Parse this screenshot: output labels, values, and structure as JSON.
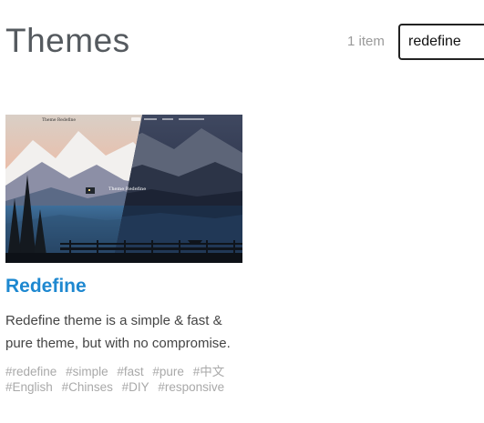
{
  "header": {
    "title": "Themes",
    "count": "1 item",
    "search_value": "redefine"
  },
  "themes": [
    {
      "name": "Redefine",
      "description": "Redefine theme is a simple & fast & pure theme, but with no compromise.",
      "preview": {
        "site_title": "Theme Redefine",
        "hero_text": "Theme Redefine"
      },
      "tags": [
        "#redefine",
        "#simple",
        "#fast",
        "#pure",
        "#中文",
        "#English",
        "#Chinses",
        "#DIY",
        "#responsive"
      ]
    }
  ]
}
